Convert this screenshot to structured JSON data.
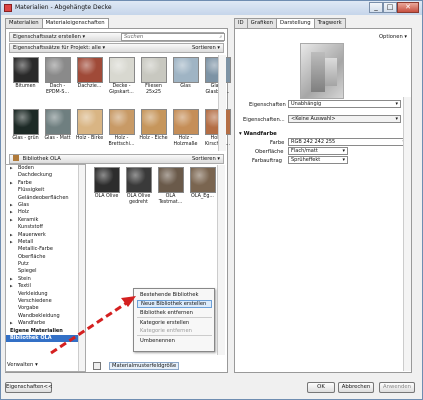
{
  "window": {
    "title": "Materialien - Abgehängte Decke",
    "buttons": [
      "_",
      "□",
      "✕"
    ]
  },
  "left_tabs": [
    "Materialien",
    "Materialeigenschaften"
  ],
  "toolbar": {
    "create_set": "Eigenschaftssatz erstellen ▾",
    "search_placeholder": "Suchen"
  },
  "project_bar": {
    "label": "Eigenschaftssätze für Projekt: alle ▾",
    "sort": "Sortieren ▾"
  },
  "project_materials": [
    {
      "label": "Bitumen",
      "color": "#2a2a2a"
    },
    {
      "label": "Dach - EPDM-S...",
      "color": "#8a8a8a"
    },
    {
      "label": "Dachzie...",
      "color": "#a04a38"
    },
    {
      "label": "Decke - Gipskart...",
      "color": "#d8d8d0"
    },
    {
      "label": "Fliesen 25x25",
      "color": "#c8c8c0"
    },
    {
      "label": "Glas",
      "color": "#9fb4c4"
    },
    {
      "label": "Glas - Glasbau...",
      "color": "#7d93a5"
    },
    {
      "label": "Glas - grün",
      "color": "#1d2a26"
    },
    {
      "label": "Glas - Matt",
      "color": "#6f7f80"
    },
    {
      "label": "Holz - Birke",
      "color": "#d9b584"
    },
    {
      "label": "Holz - Brettschi...",
      "color": "#c89a66"
    },
    {
      "label": "Holz - Eiche",
      "color": "#c6965c"
    },
    {
      "label": "Holz - Holzmaße",
      "color": "#c58e58"
    },
    {
      "label": "Holz - Kirschba...",
      "color": "#b46e45"
    }
  ],
  "library_bar": {
    "label": "Bibliothek OLA",
    "sort": "Sortieren ▾"
  },
  "library_tree": [
    {
      "label": "Boden",
      "arrow": true
    },
    {
      "label": "Dachdeckung",
      "arrow": false
    },
    {
      "label": "Farbe",
      "arrow": true
    },
    {
      "label": "Flüssigkeit",
      "arrow": false
    },
    {
      "label": "Geländeoberflächen",
      "arrow": false
    },
    {
      "label": "Glas",
      "arrow": true
    },
    {
      "label": "Holz",
      "arrow": true
    },
    {
      "label": "Keramik",
      "arrow": true
    },
    {
      "label": "Kunststoff",
      "arrow": false
    },
    {
      "label": "Mauerwerk",
      "arrow": true
    },
    {
      "label": "Metall",
      "arrow": true
    },
    {
      "label": "Metallic-Farbe",
      "arrow": false
    },
    {
      "label": "Oberfläche",
      "arrow": false
    },
    {
      "label": "Putz",
      "arrow": false
    },
    {
      "label": "Spiegel",
      "arrow": false
    },
    {
      "label": "Stein",
      "arrow": true
    },
    {
      "label": "Textil",
      "arrow": true
    },
    {
      "label": "Verkleidung",
      "arrow": false
    },
    {
      "label": "Verschiedene",
      "arrow": false
    },
    {
      "label": "Vorgabe",
      "arrow": false
    },
    {
      "label": "Wandbekleidung",
      "arrow": false
    },
    {
      "label": "Wandfarbe",
      "arrow": true
    },
    {
      "label": "Eigene Materialien",
      "arrow": false,
      "bold": true
    },
    {
      "label": "Bibliothek OLA",
      "arrow": false,
      "bold": true,
      "selected": true
    }
  ],
  "library_materials": [
    {
      "label": "OLA Olive",
      "color": "#2d2d2d"
    },
    {
      "label": "OLA Olive gedreht",
      "color": "#3a3a3a"
    },
    {
      "label": "OLA Testmat...",
      "color": "#6a5a4a"
    },
    {
      "label": "OLA_Eg...",
      "color": "#7a6550"
    }
  ],
  "bottom_left": {
    "manage": "Verwalten ▾",
    "size_label": "Materialmusterfeldgröße"
  },
  "context_menu": [
    {
      "label": "Bestehende Bibliothek öffnen",
      "enabled": true
    },
    {
      "label": "Neue Bibliothek erstellen",
      "enabled": true,
      "highlighted": true
    },
    {
      "label": "Bibliothek entfernen",
      "enabled": true
    },
    {
      "label": "Kategorie erstellen",
      "enabled": true
    },
    {
      "label": "Kategorie entfernen",
      "enabled": false
    },
    {
      "label": "Umbenennen",
      "enabled": true
    }
  ],
  "right_tabs": [
    "ID",
    "Grafiken",
    "Darstellung",
    "Tragwerk"
  ],
  "right": {
    "options": "Optionen ▾",
    "properties_label": "Eigenschaften",
    "properties_value": "Unabhängig",
    "props2_label": "Eigenschaften...",
    "props2_value": "<Keine Auswahl>",
    "section": "Wandfarbe",
    "farbe_label": "Farbe",
    "farbe_value": "RGB 242 242 255",
    "farbe_color": "#f2f2ff",
    "oberflaeche_label": "Oberfläche",
    "oberflaeche_value": "Flach/matt",
    "farbauftrag_label": "Farbauftrag",
    "farbauftrag_value": "Sprüheffekt"
  },
  "footer": {
    "properties": "Eigenschaften<<",
    "ok": "OK",
    "cancel": "Abbrechen",
    "apply": "Anwenden"
  },
  "arrow_color": "#d42020"
}
